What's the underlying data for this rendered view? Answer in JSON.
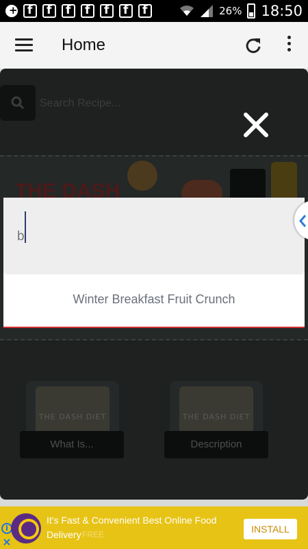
{
  "status_bar": {
    "battery_percent": "26%",
    "time": "18:50",
    "notification_icons": [
      "plus-icon",
      "facebook-icon",
      "facebook-icon",
      "facebook-icon",
      "facebook-icon",
      "facebook-icon",
      "facebook-icon",
      "facebook-icon"
    ]
  },
  "app_bar": {
    "title": "Home"
  },
  "search": {
    "placeholder": "Search Recipe..."
  },
  "banner": {
    "headline": "THE DASH"
  },
  "cards": [
    {
      "label": "What Is...",
      "image_text": "THE DASH DIET"
    },
    {
      "label": "Description",
      "image_text": "THE DASH DIET"
    }
  ],
  "overlay": {
    "input_value": "b",
    "suggestion": "Winter Breakfast Fruit Crunch"
  },
  "ad": {
    "title": "It's Fast & Convenient Best Online Food Delivery",
    "subtitle": "FREE",
    "install_label": "INSTALL",
    "colors": {
      "background": "#e7c315",
      "logo": "#5b2b84"
    }
  },
  "colors": {
    "dialog_accent": "#d32f2f",
    "app_bar": "#f4f4f4"
  }
}
